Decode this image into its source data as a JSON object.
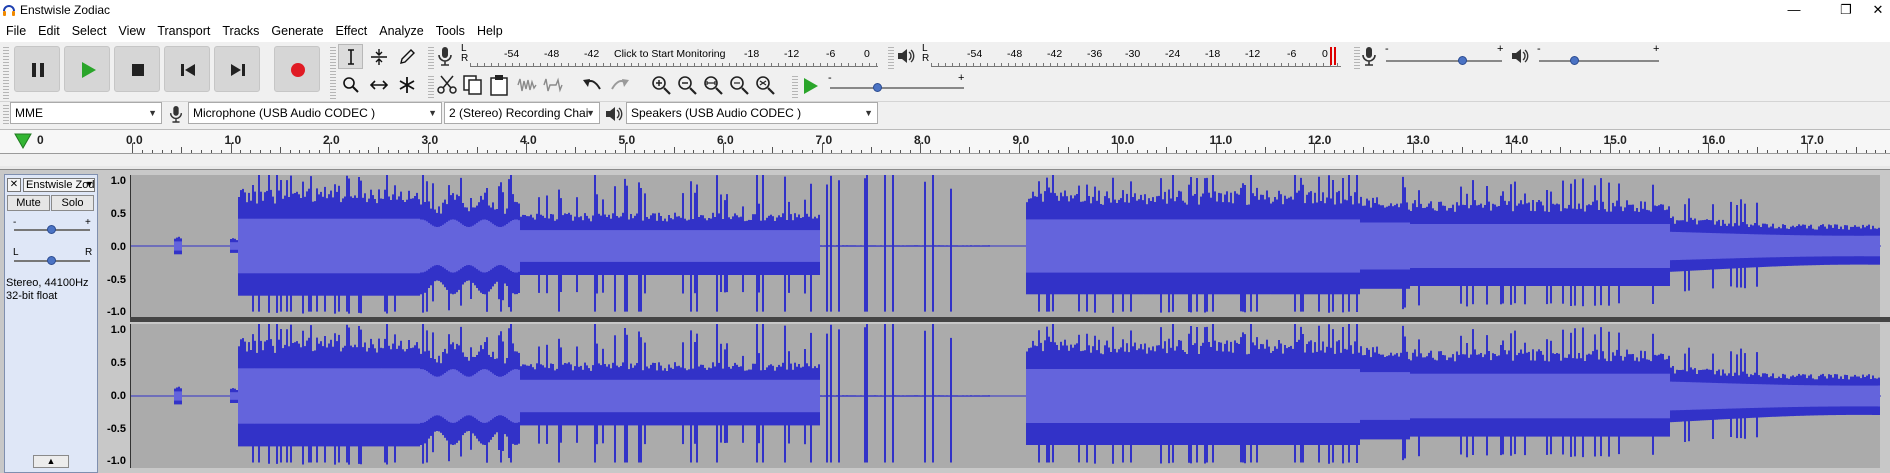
{
  "window": {
    "title": "Enstwisle Zodiac",
    "minimize": "—",
    "restore": "❐",
    "close": "✕"
  },
  "menu": [
    "File",
    "Edit",
    "Select",
    "View",
    "Transport",
    "Tracks",
    "Generate",
    "Effect",
    "Analyze",
    "Tools",
    "Help"
  ],
  "transport": {
    "buttons": [
      "pause",
      "play",
      "stop",
      "skip-to-start",
      "skip-to-end",
      "record"
    ],
    "colors": {
      "play": "#2aa52a",
      "record": "#e01b24",
      "button_bg": "#d6d6d6"
    }
  },
  "recording_meter": {
    "lr": "L\nR",
    "click_to_monitor": "Click to Start Monitoring",
    "scale": [
      "-54",
      "-48",
      "-42",
      "-18",
      "-12",
      "-6",
      "0"
    ]
  },
  "playback_meter": {
    "lr": "L\nR",
    "scale": [
      "-54",
      "-48",
      "-42",
      "-36",
      "-30",
      "-24",
      "-18",
      "-12",
      "-6",
      "0"
    ]
  },
  "mixer": {
    "record_minus": "-",
    "record_plus": "+",
    "play_minus": "-",
    "play_plus": "+",
    "record_level": 0.66,
    "play_level": 0.3
  },
  "play_at_speed": {
    "minus": "-",
    "plus": "+",
    "speed_level": 0.36
  },
  "devices": {
    "host": "MME",
    "recording_device": "Microphone (USB Audio CODEC )",
    "channels": "2 (Stereo) Recording Chai",
    "playback_device": "Speakers (USB Audio CODEC )"
  },
  "ruler": {
    "labels": [
      "0",
      "0.0",
      "1.0",
      "2.0",
      "3.0",
      "4.0",
      "5.0",
      "6.0",
      "7.0",
      "8.0",
      "9.0",
      "10.0",
      "11.0",
      "12.0",
      "13.0",
      "14.0",
      "15.0",
      "16.0",
      "17.0"
    ]
  },
  "track": {
    "name": "Enstwisle Zodiac",
    "close": "✕",
    "menu_arrow": "▼",
    "mute": "Mute",
    "solo": "Solo",
    "gain_minus": "-",
    "gain_plus": "+",
    "pan_left": "L",
    "pan_right": "R",
    "gain_level": 0.5,
    "pan_level": 0.5,
    "format_line1": "Stereo, 44100Hz",
    "format_line2": "32-bit float",
    "collapse": "▲",
    "amplitude_labels": [
      "1.0",
      "0.5",
      "0.0",
      "-0.5",
      "-1.0"
    ],
    "colors": {
      "wave": "#3232c8",
      "rms": "#6464dc",
      "background": "#ababab",
      "panel": "#dfe7f7"
    }
  }
}
